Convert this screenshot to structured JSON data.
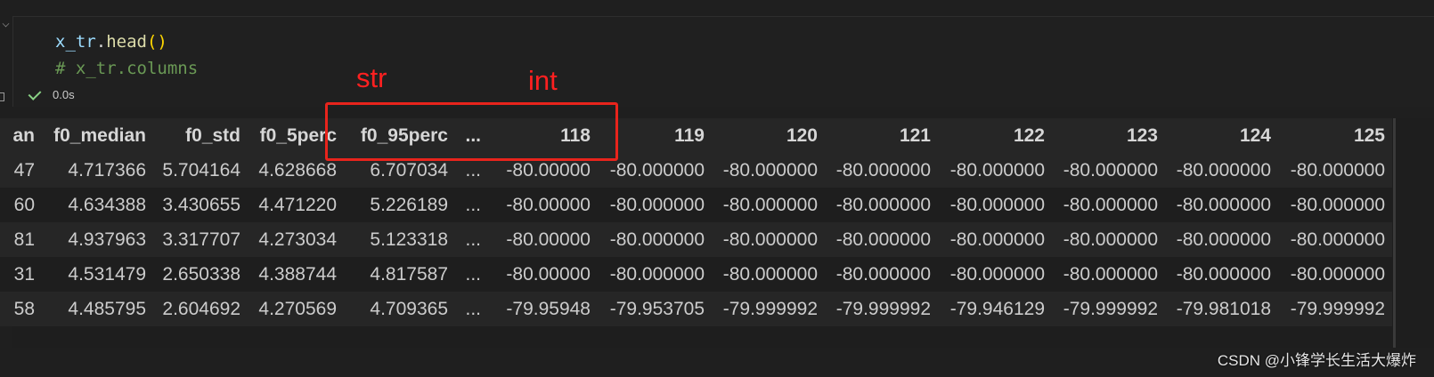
{
  "code": {
    "line1": {
      "var": "x_tr",
      "op": ".",
      "fn": "head",
      "parens": "()"
    },
    "line2": "# x_tr.columns"
  },
  "status": {
    "icon": "check-icon",
    "time": "0.0s",
    "color": "#89d185"
  },
  "annotations": {
    "str_label": "str",
    "int_label": "int",
    "color": "#ff2020"
  },
  "table": {
    "columns": [
      "an",
      "f0_median",
      "f0_std",
      "f0_5perc",
      "f0_95perc",
      "...",
      "118",
      "119",
      "120",
      "121",
      "122",
      "123",
      "124",
      "125"
    ],
    "rows": [
      [
        "47",
        "4.717366",
        "5.704164",
        "4.628668",
        "6.707034",
        "...",
        "-80.00000",
        "-80.000000",
        "-80.000000",
        "-80.000000",
        "-80.000000",
        "-80.000000",
        "-80.000000",
        "-80.000000"
      ],
      [
        "60",
        "4.634388",
        "3.430655",
        "4.471220",
        "5.226189",
        "...",
        "-80.00000",
        "-80.000000",
        "-80.000000",
        "-80.000000",
        "-80.000000",
        "-80.000000",
        "-80.000000",
        "-80.000000"
      ],
      [
        "81",
        "4.937963",
        "3.317707",
        "4.273034",
        "5.123318",
        "...",
        "-80.00000",
        "-80.000000",
        "-80.000000",
        "-80.000000",
        "-80.000000",
        "-80.000000",
        "-80.000000",
        "-80.000000"
      ],
      [
        "31",
        "4.531479",
        "2.650338",
        "4.388744",
        "4.817587",
        "...",
        "-80.00000",
        "-80.000000",
        "-80.000000",
        "-80.000000",
        "-80.000000",
        "-80.000000",
        "-80.000000",
        "-80.000000"
      ],
      [
        "58",
        "4.485795",
        "2.604692",
        "4.270569",
        "4.709365",
        "...",
        "-79.95948",
        "-79.953705",
        "-79.999992",
        "-79.999992",
        "-79.946129",
        "-79.999992",
        "-79.981018",
        "-79.999992"
      ]
    ]
  },
  "watermark": "CSDN @小锋学长生活大爆炸"
}
